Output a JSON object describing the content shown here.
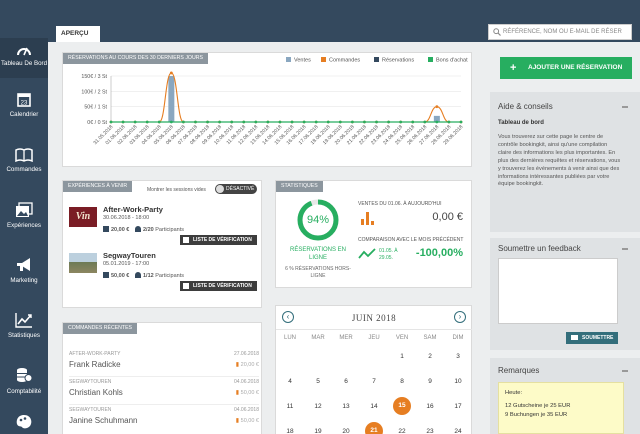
{
  "nav": [
    {
      "label": "Tableau De Bord",
      "icon": "gauge-icon"
    },
    {
      "label": "Calendrier",
      "icon": "calendar-icon"
    },
    {
      "label": "Commandes",
      "icon": "book-icon"
    },
    {
      "label": "Expériences",
      "icon": "photos-icon"
    },
    {
      "label": "Marketing",
      "icon": "megaphone-icon"
    },
    {
      "label": "Statistiques",
      "icon": "chart-up-icon"
    },
    {
      "label": "Comptabilité",
      "icon": "coins-icon"
    },
    {
      "label": "",
      "icon": "palette-icon"
    }
  ],
  "tab": "APERÇU",
  "search_placeholder": "RÉFÉRENCE, NOM OU E-MAIL DE RÉSER",
  "reservations_panel": {
    "title": "RÉSERVATIONS AU COURS DES 30 DERNIERS JOURS",
    "legend": [
      "Ventes",
      "Commandes",
      "Réservations",
      "Bons d'achat"
    ],
    "colors": {
      "ventes": "#8aa7c0",
      "commandes": "#e67e22",
      "reservations": "#34495e",
      "bons": "#27ae60"
    }
  },
  "chart_data": {
    "type": "line",
    "title": "RÉSERVATIONS AU COURS DES 30 DERNIERS JOURS",
    "y_tick_labels": [
      "150€ / 3 St",
      "100€ / 2 St",
      "50€ / 1 St",
      "0€ / 0 St"
    ],
    "ylim": [
      0,
      150
    ],
    "categories": [
      "31.05.2018",
      "01.06.2018",
      "02.06.2018",
      "03.06.2018",
      "04.06.2018",
      "05.06.2018",
      "06.06.2018",
      "07.06.2018",
      "08.06.2018",
      "09.06.2018",
      "10.06.2018",
      "11.06.2018",
      "12.06.2018",
      "13.06.2018",
      "14.06.2018",
      "15.06.2018",
      "16.06.2018",
      "17.06.2018",
      "18.06.2018",
      "19.06.2018",
      "20.06.2018",
      "21.06.2018",
      "22.06.2018",
      "23.06.2018",
      "24.06.2018",
      "25.06.2018",
      "26.06.2018",
      "27.06.2018",
      "28.06.2018",
      "29.06.2018"
    ],
    "series": [
      {
        "name": "Ventes",
        "type": "bar",
        "values": [
          0,
          0,
          0,
          0,
          0,
          150,
          0,
          0,
          0,
          0,
          0,
          0,
          0,
          0,
          0,
          0,
          0,
          0,
          0,
          0,
          0,
          0,
          0,
          0,
          0,
          0,
          0,
          20,
          0,
          0
        ]
      },
      {
        "name": "Commandes",
        "type": "line",
        "values": [
          0,
          0,
          0,
          0,
          0,
          160,
          0,
          0,
          0,
          0,
          0,
          0,
          0,
          0,
          0,
          0,
          0,
          0,
          0,
          0,
          0,
          0,
          0,
          0,
          0,
          0,
          0,
          50,
          0,
          0
        ]
      },
      {
        "name": "Réservations",
        "type": "line",
        "values": [
          0,
          0,
          0,
          0,
          0,
          0,
          0,
          0,
          0,
          0,
          0,
          0,
          0,
          0,
          0,
          0,
          0,
          0,
          0,
          0,
          0,
          0,
          0,
          0,
          0,
          0,
          0,
          0,
          0,
          0
        ]
      },
      {
        "name": "Bons d'achat",
        "type": "line",
        "values": [
          0,
          0,
          0,
          0,
          0,
          0,
          0,
          0,
          0,
          0,
          0,
          0,
          0,
          0,
          0,
          0,
          0,
          0,
          0,
          0,
          0,
          0,
          0,
          0,
          0,
          0,
          0,
          0,
          0,
          0
        ]
      }
    ],
    "grid": true,
    "legend_position": "top-right"
  },
  "experiences": {
    "title": "EXPÉRIENCES À VENIR",
    "toggle_label": "Montrer les sessions vides",
    "toggle_state": "DÉSACTIVÉ",
    "items": [
      {
        "thumb_text": "Vin",
        "name": "After-Work-Party",
        "date": "30.06.2018 - 18:00",
        "price": "20,00 €",
        "participants": "2/20",
        "participants_label": "Participants",
        "button": "LISTE DE VÉRIFICATION"
      },
      {
        "thumb_text": "",
        "name": "SegwayTouren",
        "date": "05.01.2019 - 17:00",
        "price": "50,00 €",
        "participants": "1/12",
        "participants_label": "Participants",
        "button": "LISTE DE VÉRIFICATION"
      }
    ]
  },
  "stats": {
    "title": "STATISTIQUES",
    "percent": "94%",
    "percent_value": 0.94,
    "online_label_1": "RÉSERVATIONS EN",
    "online_label_2": "LIGNE",
    "offline_label_1": "6 % RÉSERVATIONS HORS-",
    "offline_label_2": "LIGNE",
    "sales_label": "VENTES DU 01.06. À AUJOURD'HUI",
    "sales_value": "0,00 €",
    "compare_label": "COMPARAISON AVEC LE MOIS PRÉCÉDENT",
    "compare_dates_1": "01.05. À",
    "compare_dates_2": "29.05.",
    "compare_value": "-100,00%"
  },
  "orders": {
    "title": "COMMANDES RÉCENTES",
    "rows": [
      {
        "category": "AFTER-WORK-PARTY",
        "name": "Frank Radicke",
        "date": "27.06.2018",
        "amount": "20,00 €"
      },
      {
        "category": "SEGWAYTOUREN",
        "name": "Christian Kohls",
        "date": "04.06.2018",
        "amount": "50,00 €"
      },
      {
        "category": "SEGWAYTOUREN",
        "name": "Janine Schuhmann",
        "date": "04.06.2018",
        "amount": "50,00 €"
      }
    ]
  },
  "calendar": {
    "month": "JUIN 2018",
    "weekdays": [
      "LUN",
      "MAR",
      "MER",
      "JEU",
      "VEN",
      "SAM",
      "DIM"
    ],
    "weeks": [
      [
        "",
        "",
        "",
        "",
        "1",
        "2",
        "3"
      ],
      [
        "4",
        "5",
        "6",
        "7",
        "8",
        "9",
        "10"
      ],
      [
        "11",
        "12",
        "13",
        "14",
        "15",
        "16",
        "17"
      ],
      [
        "18",
        "19",
        "20",
        "21",
        "22",
        "23",
        "24"
      ]
    ],
    "highlighted": [
      "15",
      "21"
    ]
  },
  "sidebar_right": {
    "add_button": "AJOUTER UNE RÉSERVATION",
    "help_title": "Aide & conseils",
    "help_subtitle": "Tableau de bord",
    "help_text": "Vous trouverez sur cette page le centre de contrôle bookingkit, ainsi qu'une compilation claire des informations les plus importantes. En plus des dernières requêtes et réservations, vous y trouverez les événements à venir ainsi que des informations intéressantes publiées par votre équipe bookingkit.",
    "feedback_title": "Soumettre un feedback",
    "feedback_button": "SOUMETTRE",
    "remarks_title": "Remarques",
    "remarks_lines": [
      "Heute:",
      "12 Gutscheine je 25 EUR",
      "9 Buchungen je 35 EUR"
    ]
  }
}
